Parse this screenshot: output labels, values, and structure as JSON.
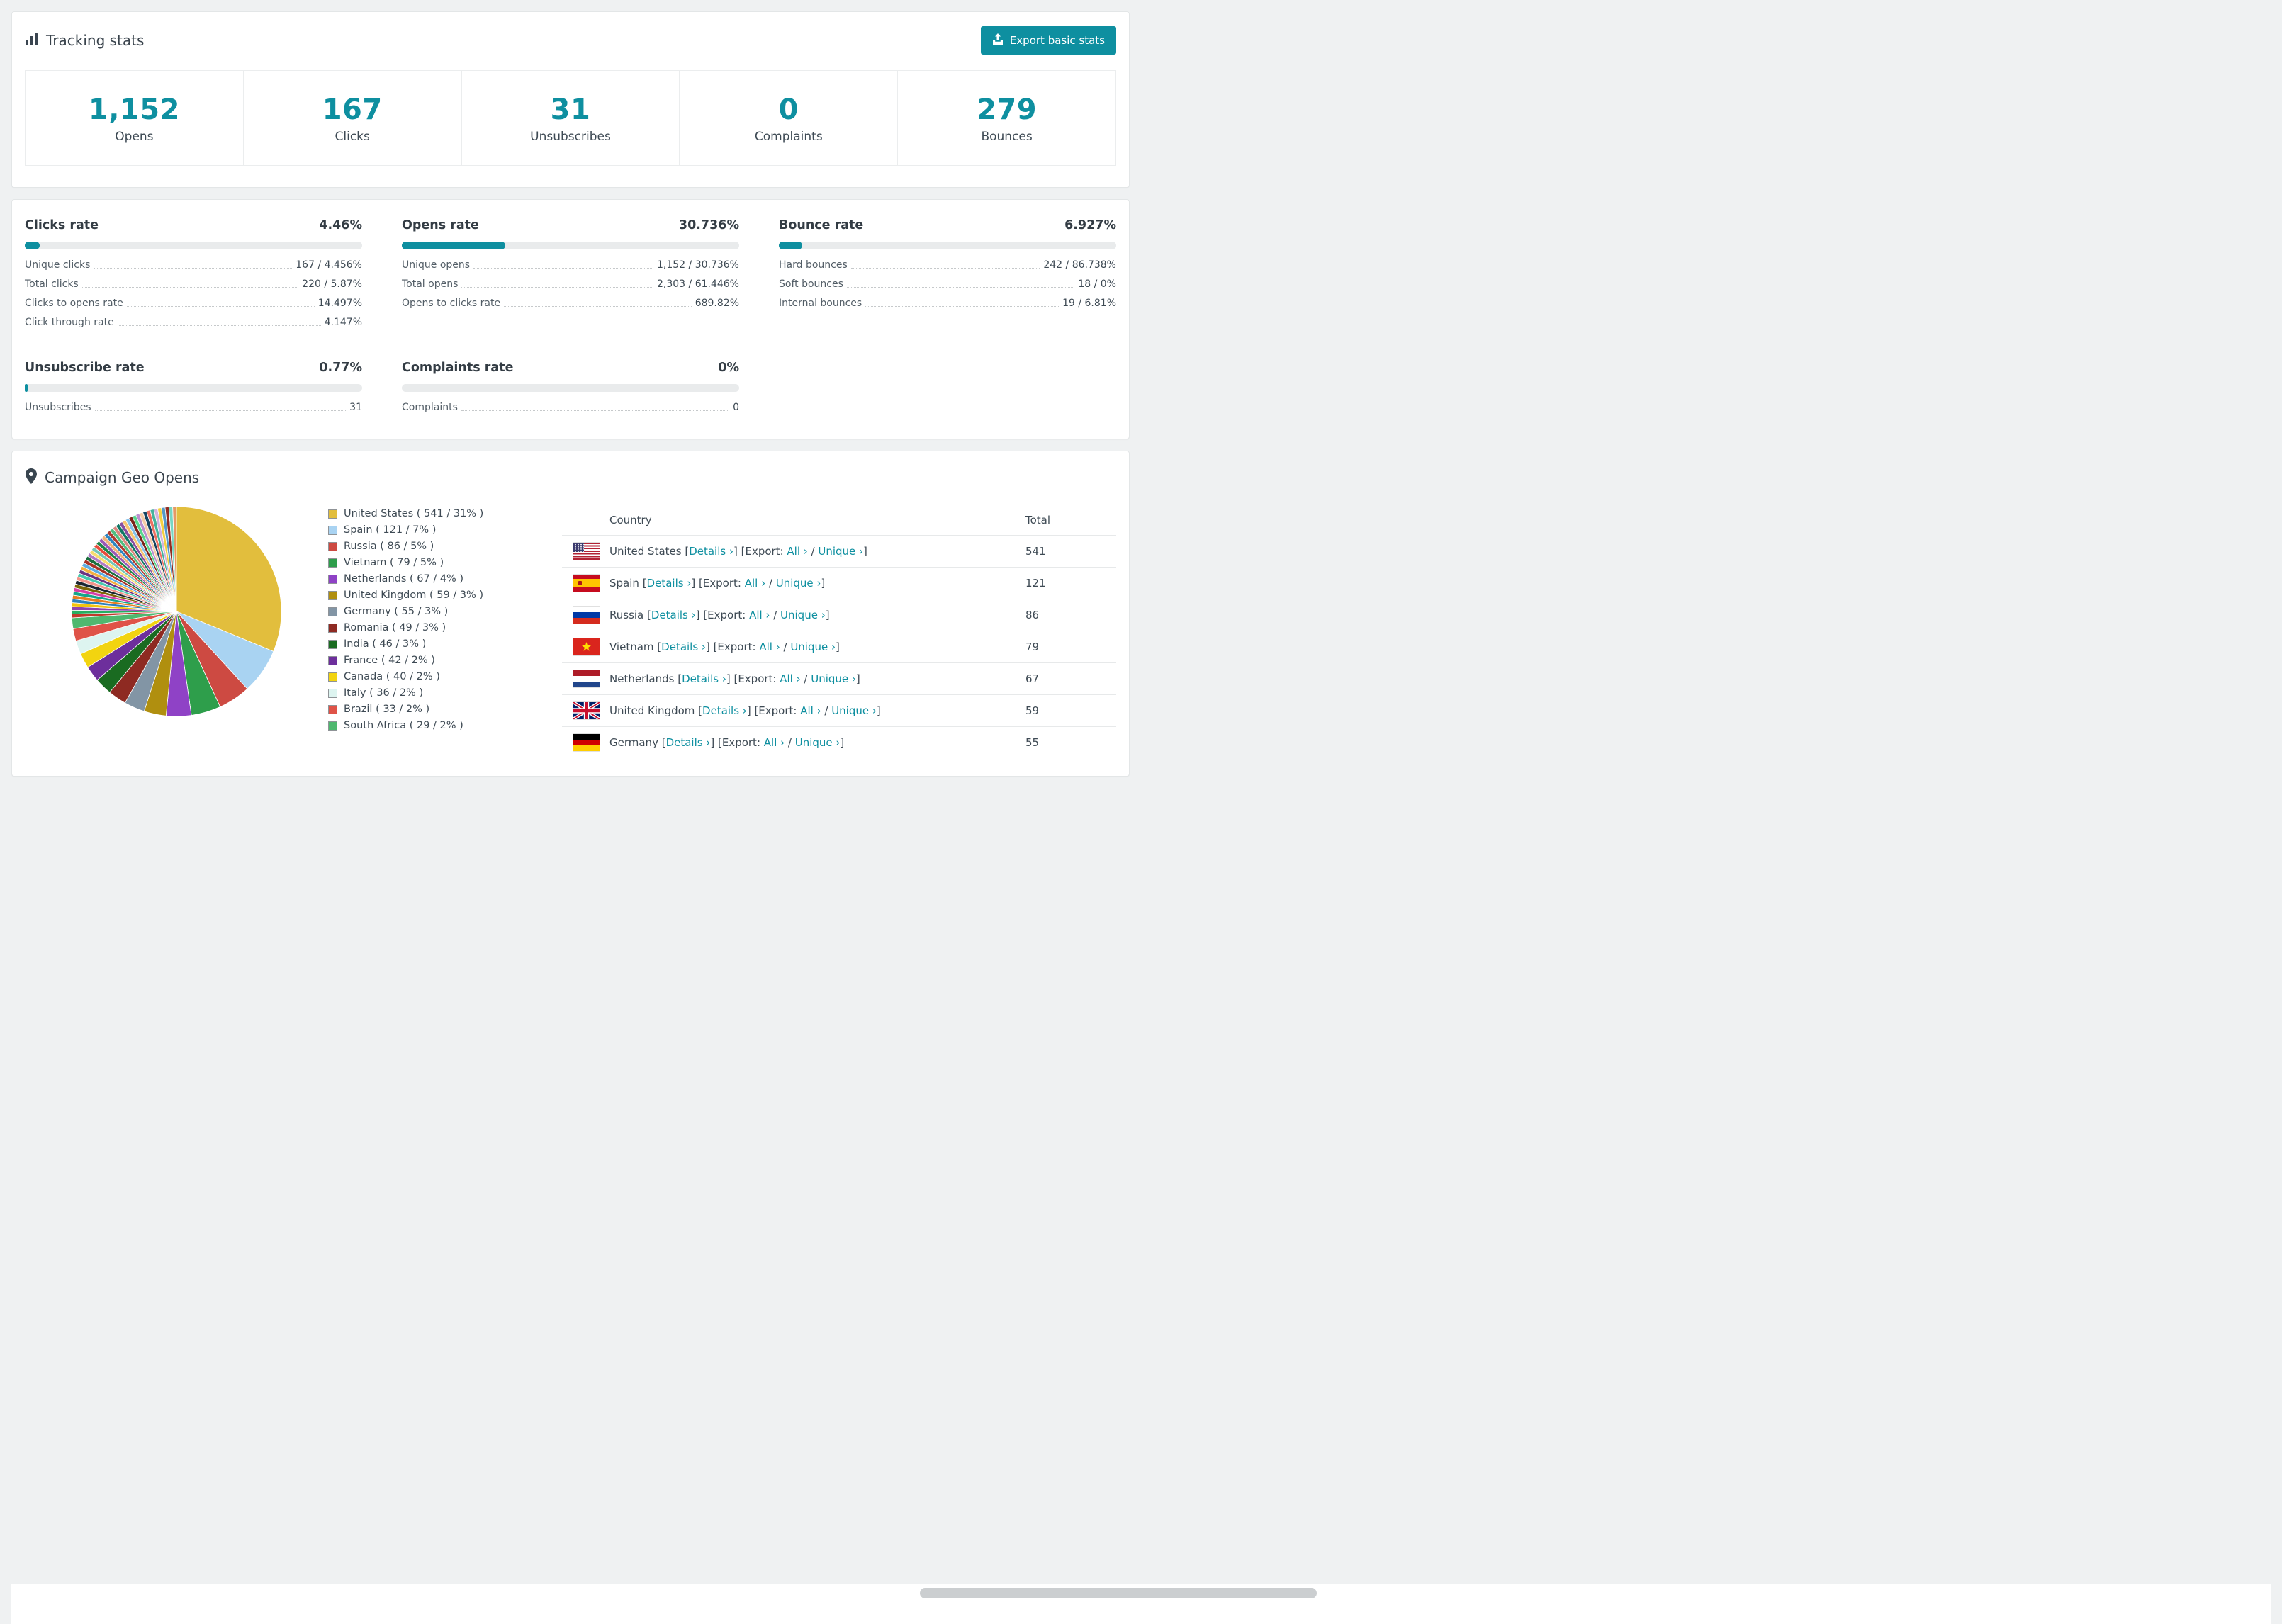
{
  "colors": {
    "accent": "#0E8FA0",
    "bar_track": "#E9EBEC"
  },
  "tracking": {
    "title": "Tracking stats",
    "export_button": "Export basic stats",
    "stats": [
      {
        "value": "1,152",
        "label": "Opens"
      },
      {
        "value": "167",
        "label": "Clicks"
      },
      {
        "value": "31",
        "label": "Unsubscribes"
      },
      {
        "value": "0",
        "label": "Complaints"
      },
      {
        "value": "279",
        "label": "Bounces"
      }
    ]
  },
  "rates": {
    "clicks": {
      "title": "Clicks rate",
      "percent": "4.46%",
      "bar_width": "4.46%",
      "rows": [
        {
          "label": "Unique clicks",
          "value": "167 / 4.456%"
        },
        {
          "label": "Total clicks",
          "value": "220 / 5.87%"
        },
        {
          "label": "Clicks to opens rate",
          "value": "14.497%"
        },
        {
          "label": "Click through rate",
          "value": "4.147%"
        }
      ]
    },
    "opens": {
      "title": "Opens rate",
      "percent": "30.736%",
      "bar_width": "30.736%",
      "rows": [
        {
          "label": "Unique opens",
          "value": "1,152 / 30.736%"
        },
        {
          "label": "Total opens",
          "value": "2,303 / 61.446%"
        },
        {
          "label": "Opens to clicks rate",
          "value": "689.82%"
        }
      ]
    },
    "bounce": {
      "title": "Bounce rate",
      "percent": "6.927%",
      "bar_width": "6.927%",
      "rows": [
        {
          "label": "Hard bounces",
          "value": "242 / 86.738%"
        },
        {
          "label": "Soft bounces",
          "value": "18 / 0%"
        },
        {
          "label": "Internal bounces",
          "value": "19 / 6.81%"
        }
      ]
    },
    "unsubscribe": {
      "title": "Unsubscribe rate",
      "percent": "0.77%",
      "bar_width": "0.77%",
      "rows": [
        {
          "label": "Unsubscribes",
          "value": "31"
        }
      ]
    },
    "complaints": {
      "title": "Complaints rate",
      "percent": "0%",
      "bar_width": "0%",
      "rows": [
        {
          "label": "Complaints",
          "value": "0"
        }
      ]
    }
  },
  "geo": {
    "title": "Campaign Geo Opens",
    "legend": [
      {
        "label": "United States ( 541 / 31% )",
        "color": "#E2BE3D"
      },
      {
        "label": "Spain ( 121 / 7% )",
        "color": "#A9D3F2"
      },
      {
        "label": "Russia ( 86 / 5% )",
        "color": "#CD4A42"
      },
      {
        "label": "Vietnam ( 79 / 5% )",
        "color": "#2E9E4B"
      },
      {
        "label": "Netherlands ( 67 / 4% )",
        "color": "#8F42C6"
      },
      {
        "label": "United Kingdom ( 59 / 3% )",
        "color": "#B08F0F"
      },
      {
        "label": "Germany ( 55 / 3% )",
        "color": "#8295A5"
      },
      {
        "label": "Romania ( 49 / 3% )",
        "color": "#8E2A22"
      },
      {
        "label": "India ( 46 / 3% )",
        "color": "#1A6B21"
      },
      {
        "label": "France ( 42 / 2% )",
        "color": "#6D2F9C"
      },
      {
        "label": "Canada ( 40 / 2% )",
        "color": "#F2D410"
      },
      {
        "label": "Italy ( 36 / 2% )",
        "color": "#DDF4F0"
      },
      {
        "label": "Brazil ( 33 / 2% )",
        "color": "#DF5348"
      },
      {
        "label": "South Africa ( 29 / 2% )",
        "color": "#4FB86F"
      }
    ],
    "table": {
      "country_header": "Country",
      "total_header": "Total",
      "t_lb": " [",
      "t_rb": "]",
      "t_export": " [Export: ",
      "t_slash": " / ",
      "links": {
        "details": "Details ›",
        "all": "All ›",
        "unique": "Unique ›"
      },
      "rows": [
        {
          "country": "United States",
          "total": "541",
          "flag": "us"
        },
        {
          "country": "Spain",
          "total": "121",
          "flag": "es"
        },
        {
          "country": "Russia",
          "total": "86",
          "flag": "ru"
        },
        {
          "country": "Vietnam",
          "total": "79",
          "flag": "vn"
        },
        {
          "country": "Netherlands",
          "total": "67",
          "flag": "nl"
        },
        {
          "country": "United Kingdom",
          "total": "59",
          "flag": "gb"
        },
        {
          "country": "Germany",
          "total": "55",
          "flag": "de"
        }
      ]
    }
  },
  "chart_data": {
    "type": "pie",
    "title": "Campaign Geo Opens",
    "unit": "opens",
    "legend_position": "right",
    "series": [
      {
        "name": "United States",
        "value": 541,
        "percent": "31%",
        "color": "#E2BE3D"
      },
      {
        "name": "Spain",
        "value": 121,
        "percent": "7%",
        "color": "#A9D3F2"
      },
      {
        "name": "Russia",
        "value": 86,
        "percent": "5%",
        "color": "#CD4A42"
      },
      {
        "name": "Vietnam",
        "value": 79,
        "percent": "5%",
        "color": "#2E9E4B"
      },
      {
        "name": "Netherlands",
        "value": 67,
        "percent": "4%",
        "color": "#8F42C6"
      },
      {
        "name": "United Kingdom",
        "value": 59,
        "percent": "3%",
        "color": "#B08F0F"
      },
      {
        "name": "Germany",
        "value": 55,
        "percent": "3%",
        "color": "#8295A5"
      },
      {
        "name": "Romania",
        "value": 49,
        "percent": "3%",
        "color": "#8E2A22"
      },
      {
        "name": "India",
        "value": 46,
        "percent": "3%",
        "color": "#1A6B21"
      },
      {
        "name": "France",
        "value": 42,
        "percent": "2%",
        "color": "#6D2F9C"
      },
      {
        "name": "Canada",
        "value": 40,
        "percent": "2%",
        "color": "#F2D410"
      },
      {
        "name": "Italy",
        "value": 36,
        "percent": "2%",
        "color": "#DDF4F0"
      },
      {
        "name": "Brazil",
        "value": 33,
        "percent": "2%",
        "color": "#DF5348"
      },
      {
        "name": "South Africa",
        "value": 29,
        "percent": "2%",
        "color": "#4FB86F"
      }
    ],
    "others": {
      "estimated_total": 450,
      "slice_count": 45,
      "palette": [
        "#C0392B",
        "#27AE60",
        "#8E44AD",
        "#F1C40F",
        "#2C81BA",
        "#E67E22",
        "#17A589",
        "#D63FA6",
        "#7D6608",
        "#1B2631",
        "#F1948A",
        "#48C9B0",
        "#6C3483",
        "#F5B041",
        "#5DADE2",
        "#A93226",
        "#196F3D",
        "#AF7AC5",
        "#F7DC6F",
        "#73C6B6",
        "#E74C3C",
        "#1E8449",
        "#9B59B6",
        "#F0B27A",
        "#2E86C1",
        "#B03A2E",
        "#52BE80",
        "#D98880",
        "#117864",
        "#884EA0",
        "#F8C471",
        "#85C1E9",
        "#7B241C",
        "#58D68D",
        "#BB8FCE",
        "#F5CBA7",
        "#154360",
        "#EC7063",
        "#45B39D",
        "#D2B4DE",
        "#F4D03F",
        "#5499C7",
        "#922B21",
        "#76D7C4",
        "#E59866"
      ]
    }
  }
}
